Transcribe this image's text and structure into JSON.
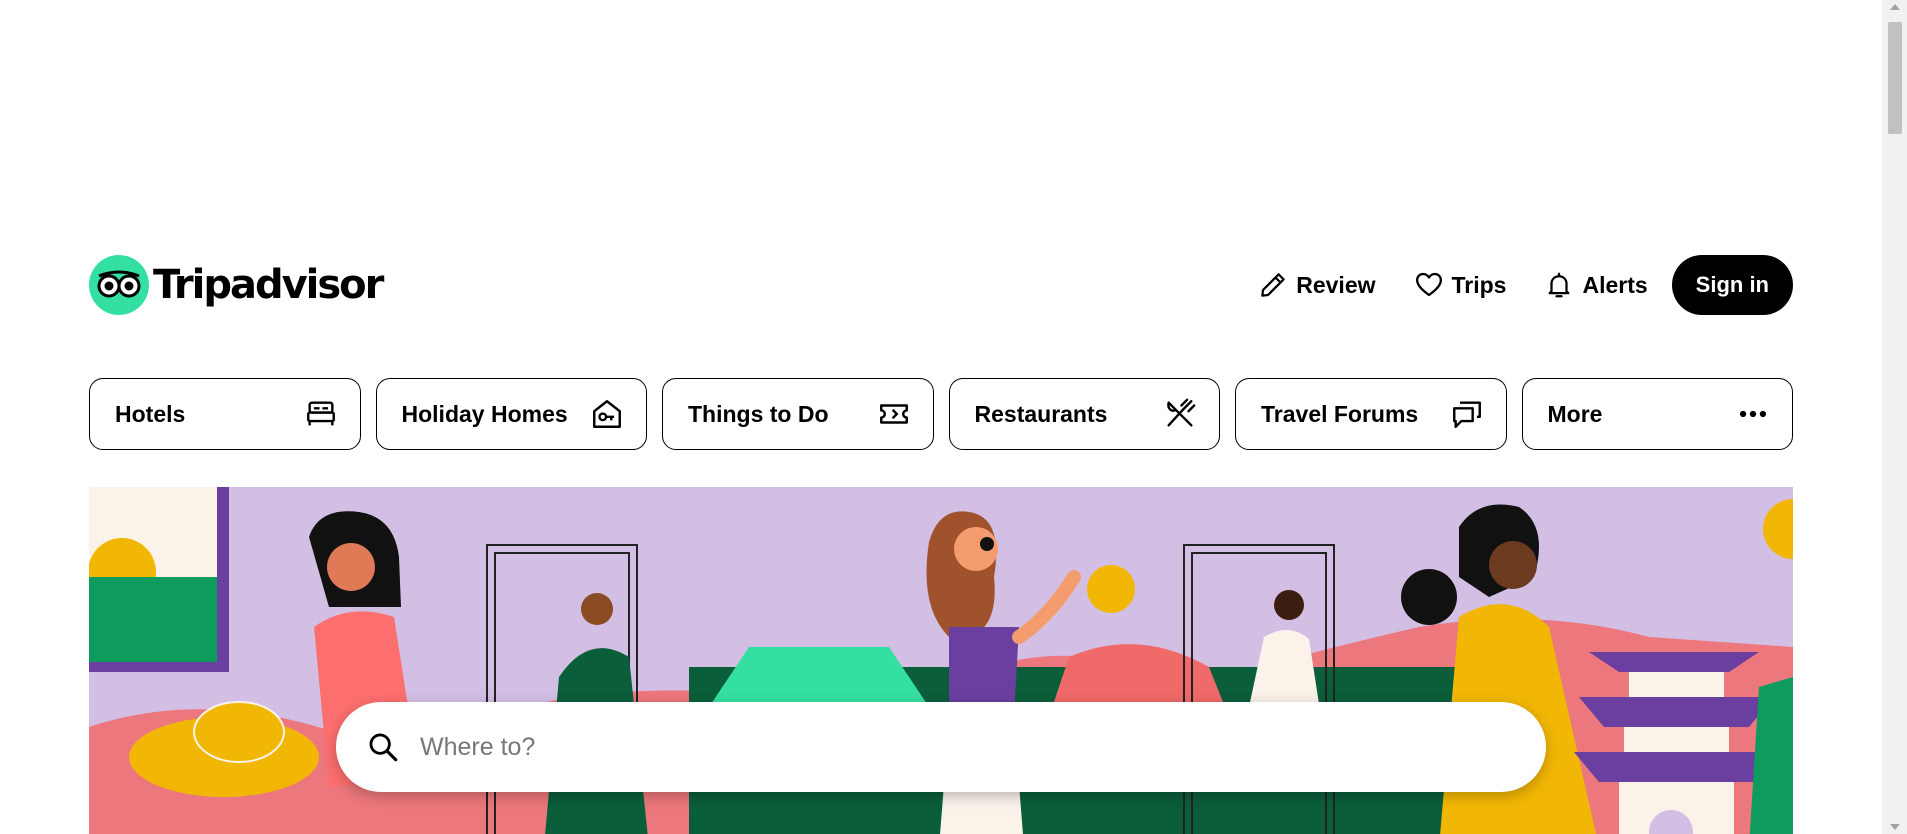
{
  "brand": {
    "name": "Tripadvisor",
    "accent": "#34e0a1"
  },
  "header": {
    "review_label": "Review",
    "trips_label": "Trips",
    "alerts_label": "Alerts",
    "signin_label": "Sign in"
  },
  "categories": [
    {
      "label": "Hotels",
      "icon": "bed-icon"
    },
    {
      "label": "Holiday Homes",
      "icon": "house-key-icon"
    },
    {
      "label": "Things to Do",
      "icon": "ticket-icon"
    },
    {
      "label": "Restaurants",
      "icon": "fork-knife-icon"
    },
    {
      "label": "Travel Forums",
      "icon": "chat-bubbles-icon"
    },
    {
      "label": "More",
      "icon": "more-dots-icon"
    }
  ],
  "search": {
    "placeholder": "Where to?",
    "value": ""
  },
  "hero": {
    "background": "#d3bfe4"
  }
}
